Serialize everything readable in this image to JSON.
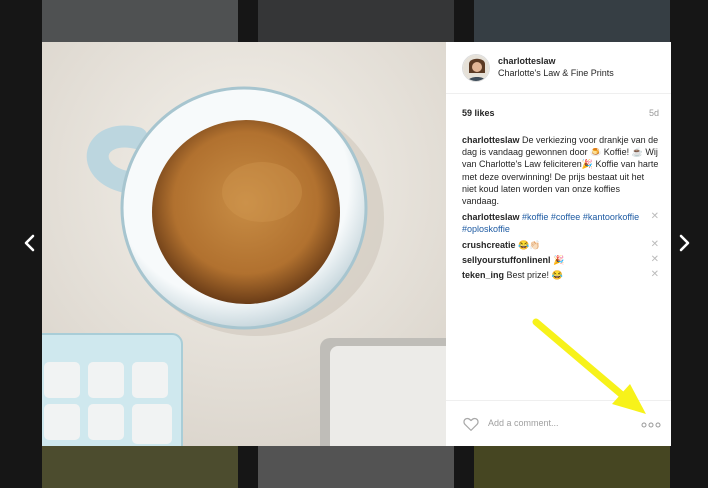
{
  "nav": {
    "prev_icon": "chevron-left-icon",
    "next_icon": "chevron-right-icon"
  },
  "post": {
    "username": "charlotteslaw",
    "location": "Charlotte's Law & Fine Prints",
    "likes": "59 likes",
    "age": "5d",
    "caption": "De verkiezing voor drankje van de dag is vandaag gewonnen door 🍮 Koffie! ☕️ Wij van Charlotte's Law feliciteren🎉 Koffie van harte met deze overwinning! De prijs bestaat uit het niet koud laten worden van onze koffies vandaag.",
    "comments": [
      {
        "user": "charlotteslaw",
        "tags": [
          "#koffie",
          "#coffee",
          "#kantoorkoffie",
          "#oploskoffie"
        ]
      },
      {
        "user": "crushcreatie",
        "text": "😂👏🏻"
      },
      {
        "user": "sellyourstuffonlinenl",
        "text": "🎉"
      },
      {
        "user": "teken_ing",
        "text": "Best prize! 😂"
      }
    ],
    "delete_glyph": "✕",
    "add_comment_placeholder": "Add a comment...",
    "more_icon": "more-options-icon",
    "heart_icon": "heart-icon"
  },
  "colors": {
    "accent_link": "#1e5ba3",
    "annotation_arrow": "#f7f21a"
  }
}
